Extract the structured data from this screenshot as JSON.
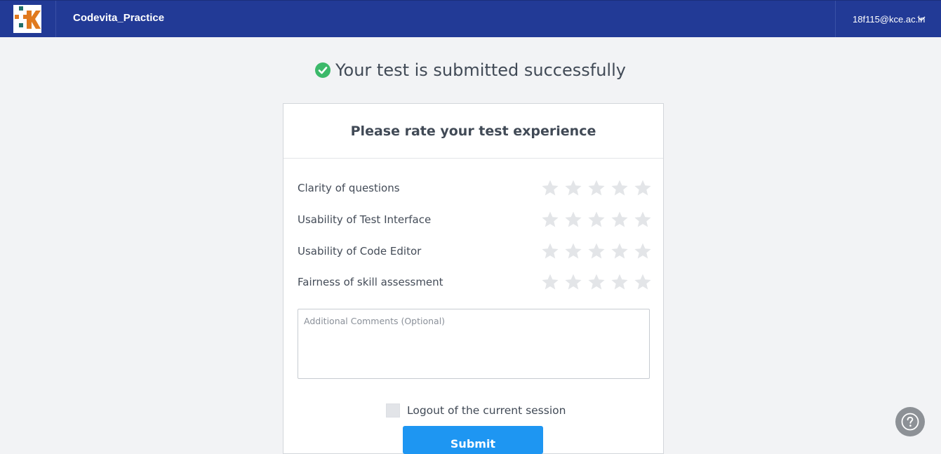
{
  "header": {
    "brand": "Codevita_Practice",
    "user_email": "18f115@kce.ac.in",
    "icons": {
      "logo": "logo-icon",
      "user_menu": "chevron-down-icon"
    },
    "colors": {
      "bar": "#223a96",
      "logo_orange": "#e07a1f",
      "logo_teal": "#1f6f6b"
    }
  },
  "status": {
    "message": "Your test is submitted successfully",
    "icon": "check-circle-icon",
    "icon_color": "#3cb96a"
  },
  "feedback": {
    "title": "Please rate your test experience",
    "ratings": [
      {
        "label": "Clarity of questions",
        "value": 0,
        "max": 5
      },
      {
        "label": "Usability of Test Interface",
        "value": 0,
        "max": 5
      },
      {
        "label": "Usability of Code Editor",
        "value": 0,
        "max": 5
      },
      {
        "label": "Fairness of skill assessment",
        "value": 0,
        "max": 5
      }
    ],
    "star_color_empty": "#e3e5e8",
    "comments_placeholder": "Additional Comments (Optional)",
    "comments_value": "",
    "logout_label": "Logout of the current session",
    "logout_checked": false,
    "submit_label": "Submit",
    "submit_color": "#1e96f2"
  },
  "help": {
    "icon": "help-icon"
  }
}
